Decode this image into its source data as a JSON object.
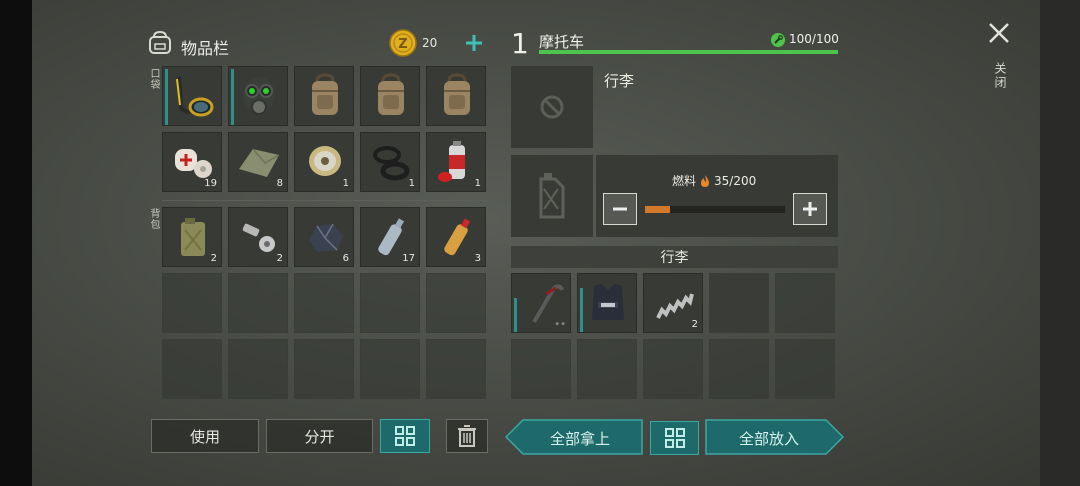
{
  "inventory": {
    "title": "物品栏",
    "coins": "20",
    "pocket_label": "口袋",
    "backpack_label": "背包",
    "pocket_row1": [
      {
        "name": "snorkel-mask",
        "count": ""
      },
      {
        "name": "gas-mask",
        "count": ""
      },
      {
        "name": "backpack",
        "count": ""
      },
      {
        "name": "backpack",
        "count": ""
      },
      {
        "name": "backpack",
        "count": ""
      }
    ],
    "pocket_row2": [
      {
        "name": "medkit-bandages",
        "count": "19"
      },
      {
        "name": "cloth",
        "count": "8"
      },
      {
        "name": "wire-spool",
        "count": "1"
      },
      {
        "name": "rubber-rings",
        "count": "1"
      },
      {
        "name": "spray-can",
        "count": "1"
      }
    ],
    "backpack_row1": [
      {
        "name": "jerrycan",
        "count": "2"
      },
      {
        "name": "bolt-nut",
        "count": "2"
      },
      {
        "name": "ore",
        "count": "6"
      },
      {
        "name": "water-bottle",
        "count": "17"
      },
      {
        "name": "juice-bottle",
        "count": "3"
      }
    ],
    "buttons": {
      "use": "使用",
      "split": "分开"
    }
  },
  "vehicle": {
    "slot_number": "1",
    "name": "摩托车",
    "durability": "100/100",
    "durability_fraction": 1.0,
    "trunk_title": "行李",
    "fuel_label": "燃料",
    "fuel_value": "35/200",
    "fuel_fraction": 0.175,
    "cargo_title": "行李",
    "cargo_row1": [
      {
        "name": "crowbar",
        "count": ""
      },
      {
        "name": "police-vest",
        "count": ""
      },
      {
        "name": "spring",
        "count": "2"
      }
    ],
    "buttons": {
      "take_all": "全部拿上",
      "put_all": "全部放入"
    }
  },
  "close": {
    "label": "关闭"
  },
  "colors": {
    "accent": "#3ba8a3",
    "health": "#4fc44a",
    "fuel": "#d4782a",
    "coin": "#e0b020"
  }
}
